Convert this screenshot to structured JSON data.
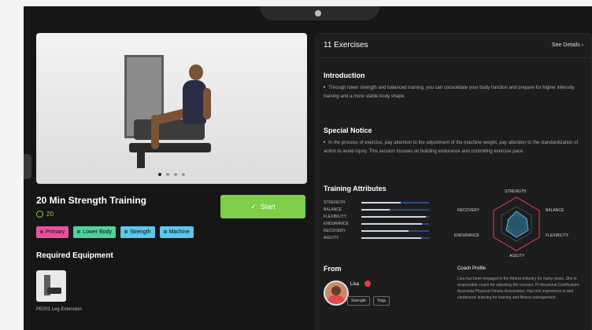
{
  "workout": {
    "title": "20 Min Strength Training",
    "duration": "20",
    "start_label": "Start",
    "tags": [
      {
        "label": "Primary",
        "color": "#e94fa0"
      },
      {
        "label": "Lower Body",
        "color": "#4dd39a"
      },
      {
        "label": "Strength",
        "color": "#5ac8e8"
      },
      {
        "label": "Machine",
        "color": "#5ac8e8"
      }
    ],
    "required_equipment_title": "Required Equipment",
    "equipment": [
      {
        "name": "PE001 Leg Extension"
      }
    ],
    "image_dots": 4,
    "image_active_dot": 0
  },
  "panel": {
    "title": "11 Exercises",
    "see_details": "See Details",
    "introduction_title": "Introduction",
    "introduction_text": "Through lower strength and balanced training, you can consolidate your body function and prepare for higher intensity training and a more stable body shape.",
    "special_notice_title": "Special Notice",
    "special_notice_text": "In the process of exercise, pay attention to the adjustment of the machine weight, pay attention to the standardization of action to avoid injury. This session focuses on building endurance and controlling exercise pace.",
    "training_attributes_title": "Training Attributes",
    "attributes": [
      {
        "label": "STRENGTH",
        "value": 0.58
      },
      {
        "label": "BALANCE",
        "value": 0.42
      },
      {
        "label": "FLEXIBILITY",
        "value": 0.95
      },
      {
        "label": "ENDURANCE",
        "value": 0.9
      },
      {
        "label": "RECOVERY",
        "value": 0.7
      },
      {
        "label": "AGILITY",
        "value": 0.88
      }
    ],
    "radar_labels": {
      "top": "STRENGTH",
      "right_upper": "BALANCE",
      "right_lower": "FLEXIBILITY",
      "bottom": "AGILITY",
      "left_lower": "ENDURANCE",
      "left_upper": "RECOVERY"
    },
    "from_title": "From",
    "coach": {
      "name": "Lisa",
      "tags": [
        "Strength",
        "Yoga"
      ]
    },
    "profile_title": "Coach Profile",
    "profile_text": "Lisa has been engaged in the fitness industry for many years. She is responsible coach for adjusting the courses. Professional Certification: Ayurveda Physical Fitness Association. Has rich experience in and continuous learning for training and fitness management."
  },
  "colors": {
    "accent_green": "#7dcf47",
    "panel_bg": "#1d1d1d",
    "page_bg": "#161616"
  }
}
